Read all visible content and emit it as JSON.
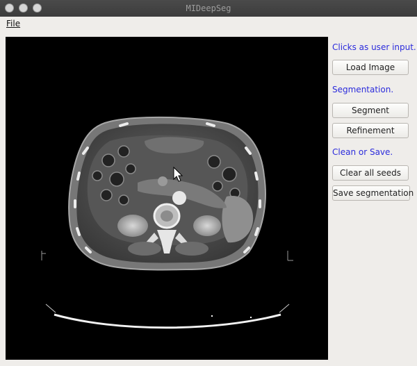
{
  "window": {
    "title": "MIDeepSeg"
  },
  "menu": {
    "file_label": "File"
  },
  "canvas": {
    "description_icon": "ct-abdomen-scan",
    "cursor_icon": "mouse-pointer-icon"
  },
  "panel": {
    "user_input_label": "Clicks as user input.",
    "load_image": "Load Image",
    "segmentation_label": "Segmentation.",
    "segment": "Segment",
    "refinement": "Refinement",
    "clean_save_label": "Clean or Save.",
    "clear_seeds": "Clear all seeds",
    "save_segmentation": "Save segmentation"
  },
  "colors": {
    "label_blue": "#2b2bdc",
    "titlebar": "#3c3c3c",
    "background": "#efedea"
  }
}
